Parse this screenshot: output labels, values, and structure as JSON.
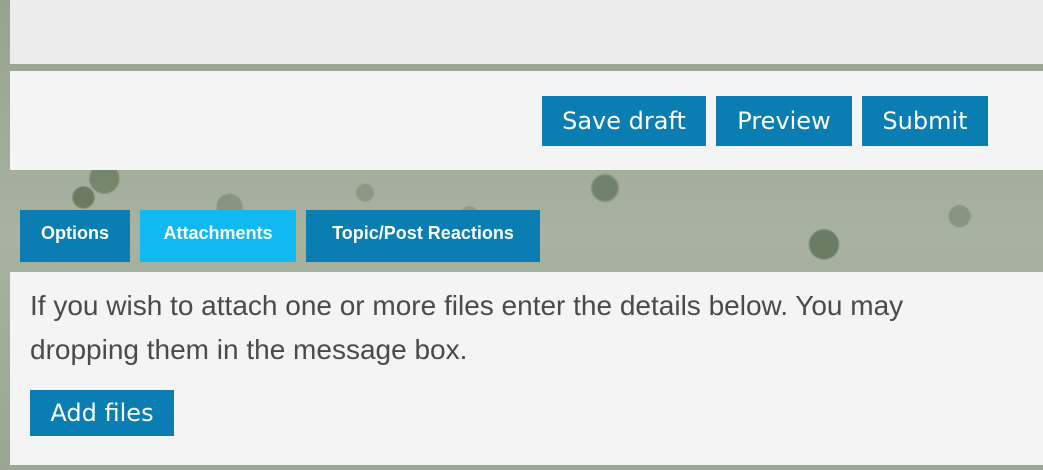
{
  "actions": {
    "save_draft": "Save draft",
    "preview": "Preview",
    "submit": "Submit"
  },
  "tabs": [
    {
      "label": "Options",
      "active": false
    },
    {
      "label": "Attachments",
      "active": true
    },
    {
      "label": "Topic/Post Reactions",
      "active": false
    }
  ],
  "attachments": {
    "help_line_1": "If you wish to attach one or more files enter the details below. You may",
    "help_line_2": "dropping them in the message box.",
    "add_files": "Add files"
  },
  "colors": {
    "button": "#0a7db3",
    "active_tab": "#10b9f2",
    "panel": "#f4f4f4",
    "text": "#4a4a4a"
  }
}
